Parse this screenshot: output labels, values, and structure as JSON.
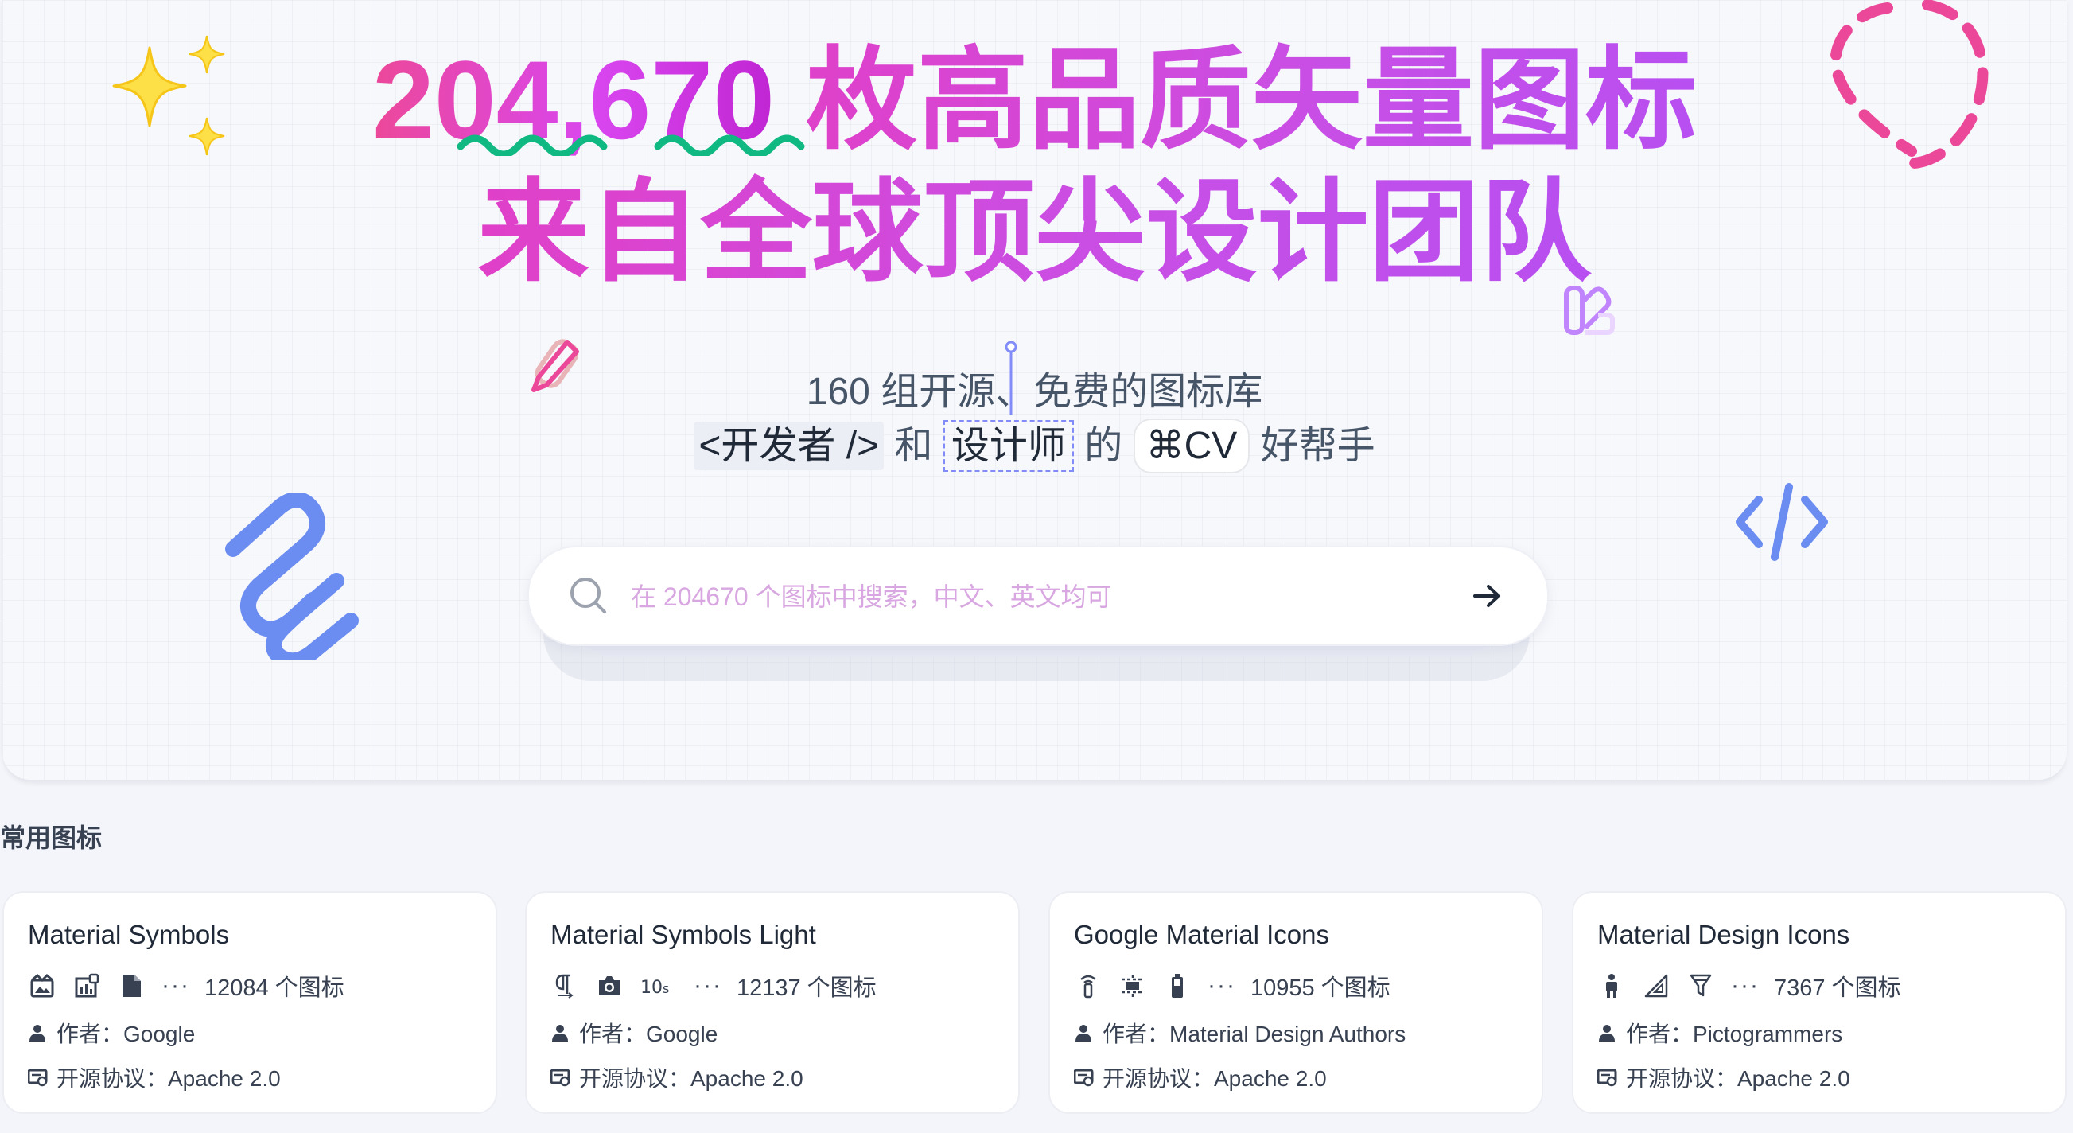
{
  "hero": {
    "title_number": "204,670",
    "title_rest": " 枚高品质矢量图标",
    "title_line2": "来自全球顶尖设计团队",
    "subtitle_line1": "160 组开源、免费的图标库",
    "tag_dev": "<开发者 />",
    "word_and": "和",
    "tag_design": "设计师",
    "word_of": "的",
    "tag_cv": "⌘CV",
    "word_helper": "好帮手"
  },
  "search": {
    "placeholder": "在 204670 个图标中搜索，中文、英文均可",
    "icon": "search-icon",
    "submit_icon": "arrow-right-icon"
  },
  "section": {
    "title": "常用图标"
  },
  "labels": {
    "author_prefix": "作者：",
    "license_prefix": "开源协议："
  },
  "cards": [
    {
      "name": "Material Symbols",
      "count": "12084 个图标",
      "author": "作者：Google",
      "license": "开源协议：Apache 2.0",
      "sample_icons": [
        "image-frame-icon",
        "chart-icon",
        "document-icon"
      ]
    },
    {
      "name": "Material Symbols Light",
      "count": "12137 个图标",
      "author": "作者：Google",
      "license": "开源协议：Apache 2.0",
      "sample_icons": [
        "paragraph-icon",
        "camera-icon",
        "timer-10s-icon"
      ]
    },
    {
      "name": "Google Material Icons",
      "count": "10955 个图标",
      "author": "作者：Material Design Authors",
      "license": "开源协议：Apache 2.0",
      "sample_icons": [
        "wifi-tower-icon",
        "crop-icon",
        "battery-icon"
      ]
    },
    {
      "name": "Material Design Icons",
      "count": "7367 个图标",
      "author": "作者：Pictogrammers",
      "license": "开源协议：Apache 2.0",
      "sample_icons": [
        "person-icon",
        "triangle-ruler-icon",
        "filter-icon"
      ]
    }
  ],
  "colors": {
    "title_gradient_start": "#ec4899",
    "title_gradient_end": "#c026d3",
    "wave_green": "#10b981",
    "accent_blue": "#6b8cf0",
    "sparkle_yellow": "#fde047"
  }
}
